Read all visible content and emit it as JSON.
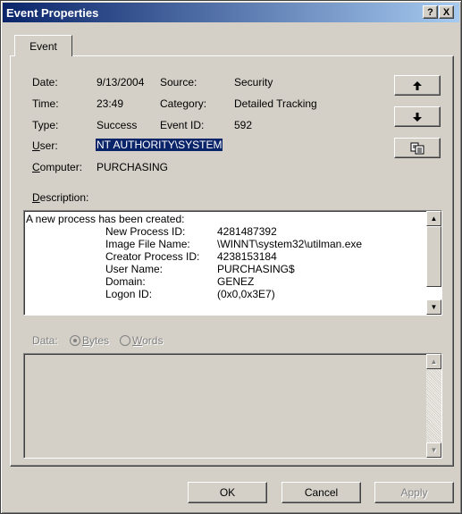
{
  "window": {
    "title": "Event Properties",
    "help_button": "?",
    "close_button": "X"
  },
  "tabs": [
    {
      "label": "Event"
    }
  ],
  "fields": {
    "date_label": "Date:",
    "date_value": "9/13/2004",
    "time_label": "Time:",
    "time_value": "23:49",
    "type_label": "Type:",
    "type_value": "Success",
    "user_label_u": "U",
    "user_label_rest": "ser:",
    "user_value": "NT AUTHORITY\\SYSTEM",
    "computer_label_u": "C",
    "computer_label_rest": "omputer:",
    "computer_value": "PURCHASING",
    "source_label": "Source:",
    "source_value": "Security",
    "category_label": "Category:",
    "category_value": "Detailed Tracking",
    "eventid_label": "Event ID:",
    "eventid_value": "592"
  },
  "side_buttons": {
    "up": "up-arrow",
    "down": "down-arrow",
    "copy": "copy-icon"
  },
  "description": {
    "label_u": "D",
    "label_rest": "escription:",
    "header": "A new process has been created:",
    "rows": [
      {
        "key": "New Process ID:",
        "value": "4281487392"
      },
      {
        "key": "Image File Name:",
        "value": "\\WINNT\\system32\\utilman.exe"
      },
      {
        "key": "Creator Process ID:",
        "value": "4238153184"
      },
      {
        "key": "User Name:",
        "value": "PURCHASING$"
      },
      {
        "key": "Domain:",
        "value": "GENEZ"
      },
      {
        "key": "Logon ID:",
        "value": "(0x0,0x3E7)"
      }
    ]
  },
  "data_section": {
    "label": "Data:",
    "bytes_u": "B",
    "bytes_rest": "ytes",
    "bytes_selected": true,
    "words_u": "W",
    "words_rest": "ords",
    "words_selected": false
  },
  "buttons": {
    "ok": "OK",
    "cancel": "Cancel",
    "apply": "Apply"
  }
}
